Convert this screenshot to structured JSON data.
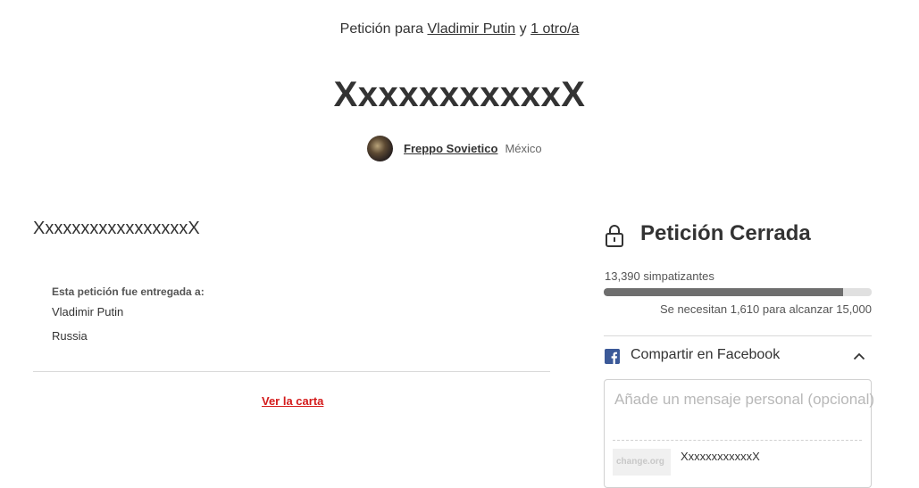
{
  "header": {
    "prefix": "Petición para",
    "recipient_link": "Vladimir Putin",
    "conjunction": "y",
    "others_link": "1 otro/a",
    "title": "XxxxxxxxxxxX"
  },
  "author": {
    "name": "Freppo Sovietico",
    "country": "México"
  },
  "main": {
    "body": "XxxxxxxxxxxxxxxxxX",
    "delivered_label": "Esta petición fue entregada a:",
    "recipients": [
      "Vladimir Putin",
      "Russia"
    ],
    "view_letter": "Ver la carta"
  },
  "sidebar": {
    "status_title": "Petición Cerrada",
    "supporters": "13,390 simpatizantes",
    "progress_fraction": 0.893,
    "goal_text": "Se necesitan 1,610 para alcanzar 15,000",
    "share_label": "Compartir en Facebook",
    "message_placeholder": "Añade un mensaje personal (opcional)",
    "preview_thumb_text": "change.org",
    "preview_title": "XxxxxxxxxxxxX"
  },
  "colors": {
    "accent_red": "#d41b1b",
    "facebook": "#3b5998",
    "progress": "#6e6e6e"
  },
  "icons": {
    "lock": "lock-icon",
    "facebook": "facebook-icon",
    "chevron": "chevron-up-icon"
  }
}
